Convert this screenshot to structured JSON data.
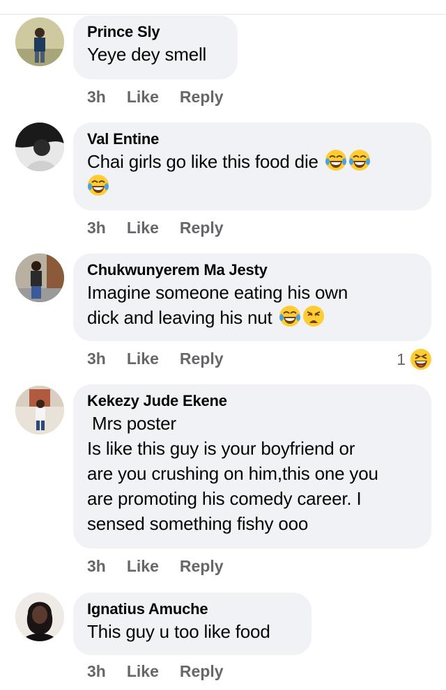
{
  "comments": [
    {
      "author": "Prince Sly",
      "text": "Yeye dey smell",
      "time": "3h",
      "like_label": "Like",
      "reply_label": "Reply",
      "avatar_color": "#9aa57a"
    },
    {
      "author": "Val Entine",
      "text": "Chai girls go like this food die",
      "emojis": [
        "face-with-tears-of-joy-icon",
        "face-with-tears-of-joy-icon",
        "face-with-tears-of-joy-icon"
      ],
      "time": "3h",
      "like_label": "Like",
      "reply_label": "Reply",
      "avatar_color": "#3a3a3a"
    },
    {
      "author": "Chukwunyerem Ma Jesty",
      "text_line1": "Imagine someone eating his own",
      "text_line2": "dick and leaving his nut",
      "emojis": [
        "face-with-tears-of-joy-icon",
        "weary-face-icon"
      ],
      "time": "3h",
      "like_label": "Like",
      "reply_label": "Reply",
      "reaction_count": "1",
      "reaction_icon": "grinning-squinting-face-icon",
      "avatar_color": "#7a6a5a"
    },
    {
      "author": "Kekezy Jude Ekene",
      "text_lines": [
        " Mrs poster",
        "Is like this guy is your boyfriend or",
        "are you crushing on him,this one you",
        "are promoting his comedy career. I",
        "sensed something fishy ooo"
      ],
      "time": "3h",
      "like_label": "Like",
      "reply_label": "Reply",
      "avatar_color": "#c8a890"
    },
    {
      "author": "Ignatius Amuche",
      "text": "This guy u too like food",
      "time": "3h",
      "like_label": "Like",
      "reply_label": "Reply",
      "avatar_color": "#2a2020"
    }
  ],
  "colors": {
    "bubble": "#f0f2f5",
    "meta_text": "#65676b",
    "name_text": "#050505"
  }
}
